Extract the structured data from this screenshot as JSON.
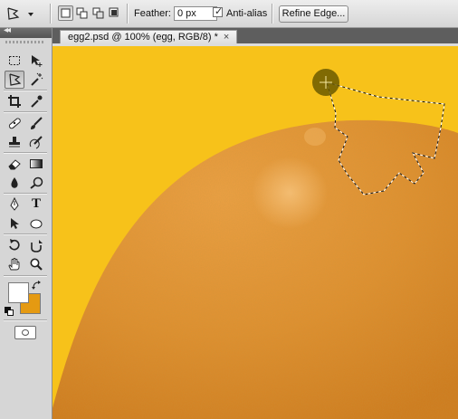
{
  "options_bar": {
    "tool_preset_icon": "polygonal-lasso-icon",
    "selection_modes": [
      "new-selection-icon",
      "add-to-selection-icon",
      "subtract-from-selection-icon",
      "intersect-selection-icon"
    ],
    "active_mode": "new-selection-icon",
    "feather_label": "Feather:",
    "feather_value": "0 px",
    "antialias_checked": true,
    "antialias_label": "Anti-alias",
    "refine_edge_label": "Refine Edge..."
  },
  "tools_panel": {
    "collapse_glyph": "◂◂",
    "tools": [
      "rectangular-marquee-icon",
      "move-icon",
      "polygonal-lasso-icon",
      "magic-wand-icon",
      "crop-icon",
      "eyedropper-icon",
      "healing-brush-icon",
      "brush-icon",
      "clone-stamp-icon",
      "history-brush-icon",
      "eraser-icon",
      "gradient-icon",
      "blur-icon",
      "dodge-icon",
      "pen-icon",
      "type-icon",
      "path-selection-icon",
      "ellipse-shape-icon",
      "rotate-view-icon",
      "3d-orbit-icon",
      "hand-icon",
      "zoom-icon"
    ],
    "active_tool": "polygonal-lasso-icon",
    "type_tool_glyph": "T",
    "foreground_color": "#ffffff",
    "background_color": "#e59a12"
  },
  "document": {
    "tab_title": "egg2.psd @ 100% (egg, RGB/8) *",
    "close_glyph": "×",
    "background_color": "#f7c21a",
    "egg_color": "#e08f2e"
  }
}
